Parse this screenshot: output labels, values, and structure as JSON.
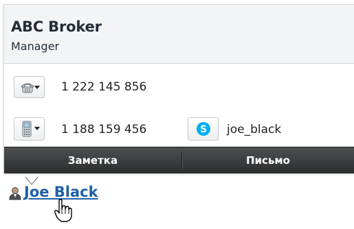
{
  "card": {
    "company": "ABC Broker",
    "role": "Manager"
  },
  "contacts": {
    "phone": {
      "icon": "desk-phone-icon",
      "value": "1 222 145 856"
    },
    "mobile": {
      "icon": "mobile-phone-icon",
      "value": "1 188 159 456"
    },
    "skype": {
      "icon": "skype-icon",
      "value": "joe_black",
      "color": "#00aff0"
    }
  },
  "actions": {
    "note_label": "Заметка",
    "letter_label": "Письмо"
  },
  "contact_link": {
    "icon": "person-icon",
    "name": "Joe Black",
    "color": "#1f5fa6"
  },
  "cursor": {
    "icon": "hand-pointer-icon"
  }
}
